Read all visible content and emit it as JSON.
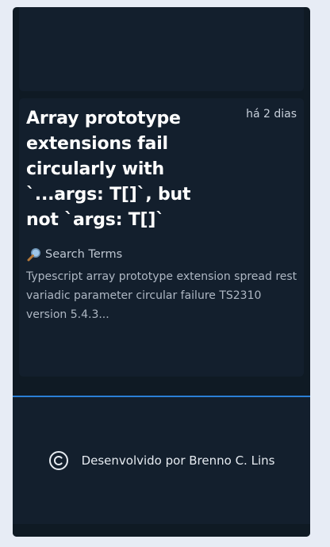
{
  "post": {
    "title": "Array prototype extensions fail circularly with `...args: T[]`, but not `args: T[]`",
    "date": "há 2 dias",
    "search_label": "Search Terms",
    "description": "Typescript array prototype extension spread rest variadic parameter circular failure TS2310 version 5.4.3..."
  },
  "footer": {
    "credit": "Desenvolvido por Brenno C. Lins"
  },
  "icons": {
    "search": "magnifier-icon",
    "copyright": "copyright-icon"
  },
  "colors": {
    "page_bg": "#e7ecf5",
    "card_bg": "#131f2d",
    "frame_bg": "#0f1a24",
    "accent_line": "#2b7fd6"
  }
}
